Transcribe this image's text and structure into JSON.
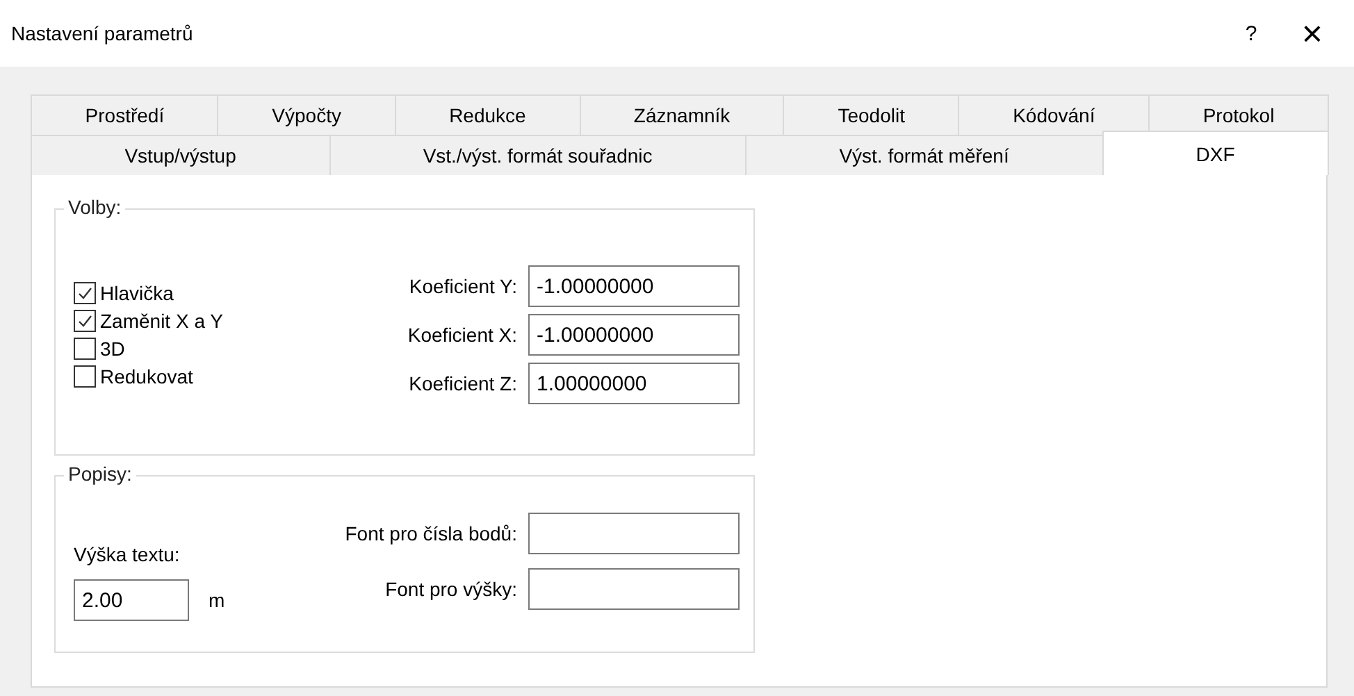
{
  "window": {
    "title": "Nastavení parametrů",
    "help": "?",
    "close": "×"
  },
  "tab_rows": [
    [
      {
        "label": "Prostředí",
        "selected": false
      },
      {
        "label": "Výpočty",
        "selected": false
      },
      {
        "label": "Redukce",
        "selected": false
      },
      {
        "label": "Záznamník",
        "selected": false
      },
      {
        "label": "Teodolit",
        "selected": false
      },
      {
        "label": "Kódování",
        "selected": false
      },
      {
        "label": "Protokol",
        "selected": false
      }
    ],
    [
      {
        "label": "Vstup/výstup",
        "selected": false
      },
      {
        "label": "Vst./výst. formát souřadnic",
        "selected": false
      },
      {
        "label": "Výst. formát měření",
        "selected": false
      },
      {
        "label": "DXF",
        "selected": true
      }
    ]
  ],
  "options": {
    "title": "Volby:",
    "checkboxes": [
      {
        "label": "Hlavička",
        "checked": true
      },
      {
        "label": "Zaměnit X a Y",
        "checked": true
      },
      {
        "label": "3D",
        "checked": false
      },
      {
        "label": "Redukovat",
        "checked": false
      }
    ],
    "coefficients": [
      {
        "label": "Koeficient Y:",
        "value": "-1.00000000"
      },
      {
        "label": "Koeficient X:",
        "value": "-1.00000000"
      },
      {
        "label": "Koeficient Z:",
        "value": "1.00000000"
      }
    ]
  },
  "labels": {
    "title": "Popisy:",
    "text_height_label": "Výška textu:",
    "text_height_value": "2.00",
    "unit": "m",
    "fonts": [
      {
        "label": "Font pro čísla bodů:"
      },
      {
        "label": "Font pro výšky:"
      }
    ]
  }
}
